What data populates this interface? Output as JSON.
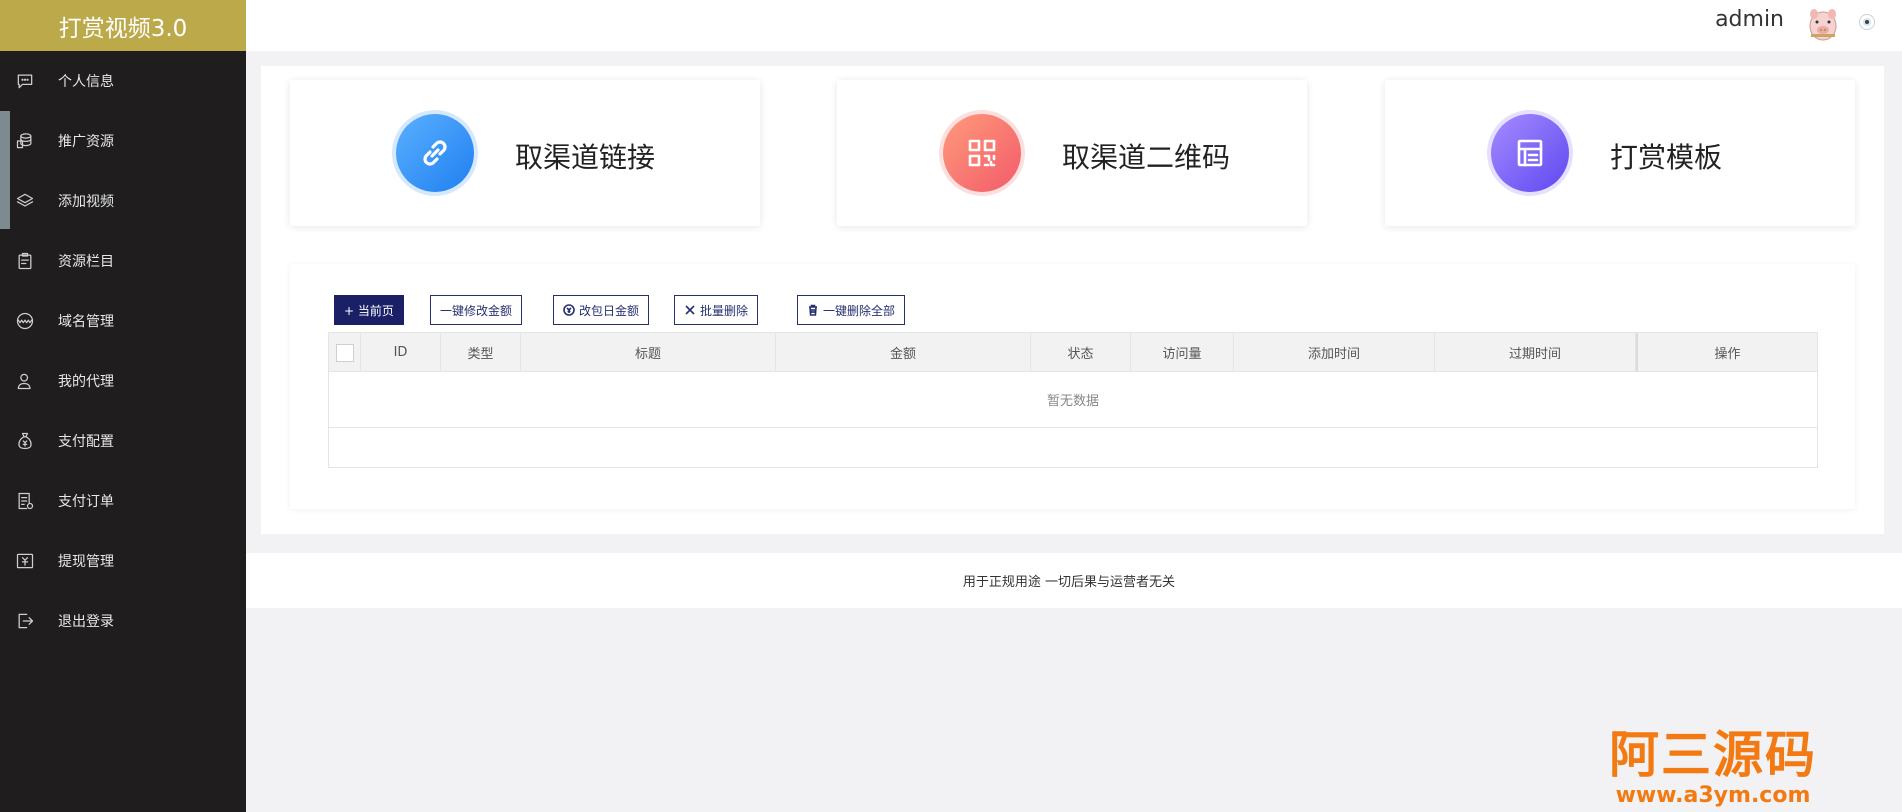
{
  "brand": {
    "title": "打赏视频3.0"
  },
  "sidebar": {
    "items": [
      {
        "label": "个人信息",
        "icon": "chat-icon"
      },
      {
        "label": "推广资源",
        "icon": "coins-icon"
      },
      {
        "label": "添加视频",
        "icon": "layers-icon"
      },
      {
        "label": "资源栏目",
        "icon": "clipboard-icon"
      },
      {
        "label": "域名管理",
        "icon": "www-icon"
      },
      {
        "label": "我的代理",
        "icon": "user-icon"
      },
      {
        "label": "支付配置",
        "icon": "money-bag-icon"
      },
      {
        "label": "支付订单",
        "icon": "order-icon"
      },
      {
        "label": "提现管理",
        "icon": "withdraw-icon"
      },
      {
        "label": "退出登录",
        "icon": "logout-icon"
      }
    ]
  },
  "header": {
    "username": "admin"
  },
  "cards": [
    {
      "title": "取渠道链接",
      "icon": "link-icon",
      "color": "#2b8df5"
    },
    {
      "title": "取渠道二维码",
      "icon": "qrcode-icon",
      "color": "#f76b6b"
    },
    {
      "title": "打赏模板",
      "icon": "template-icon",
      "color": "#7a5cf2"
    }
  ],
  "toolbar": {
    "current_page": "+ 当前页",
    "bulk_edit_amount": "一键修改金额",
    "edit_red_packet": "改包日金额",
    "batch_delete": "批量删除",
    "delete_all": "一键删除全部"
  },
  "table": {
    "columns": [
      "ID",
      "类型",
      "标题",
      "金额",
      "状态",
      "访问量",
      "添加时间",
      "过期时间",
      "操作"
    ],
    "empty_text": "暂无数据"
  },
  "footer": {
    "text": "用于正规用途 一切后果与运营者无关"
  },
  "watermark": {
    "main": "阿三源码",
    "sub": "www.a3ym.com"
  }
}
